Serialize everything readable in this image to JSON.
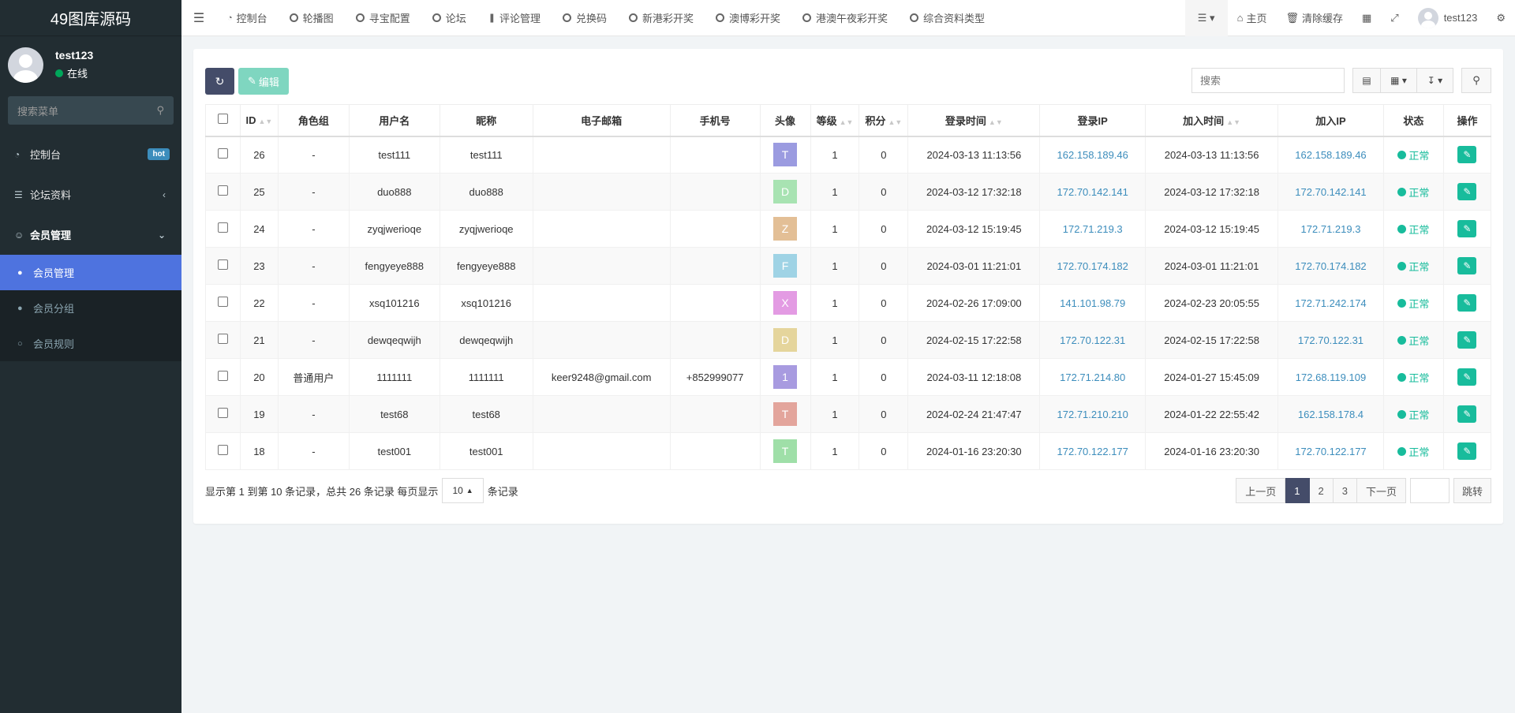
{
  "app": {
    "title": "49图库源码"
  },
  "user": {
    "name": "test123",
    "status": "在线"
  },
  "sidebar": {
    "search_placeholder": "搜索菜单",
    "items": [
      {
        "label": "控制台",
        "badge": "hot"
      },
      {
        "label": "论坛资料"
      },
      {
        "label": "会员管理"
      }
    ],
    "submenu": [
      {
        "label": "会员管理"
      },
      {
        "label": "会员分组"
      },
      {
        "label": "会员规则"
      }
    ]
  },
  "topnav": {
    "tabs": [
      {
        "label": "控制台"
      },
      {
        "label": "轮播图"
      },
      {
        "label": "寻宝配置"
      },
      {
        "label": "论坛"
      },
      {
        "label": "评论管理"
      },
      {
        "label": "兑换码"
      },
      {
        "label": "新港彩开奖"
      },
      {
        "label": "澳博彩开奖"
      },
      {
        "label": "港澳午夜彩开奖"
      },
      {
        "label": "综合资料类型"
      }
    ],
    "home": "主页",
    "clear_cache": "清除缓存",
    "user": "test123"
  },
  "toolbar": {
    "edit_label": "编辑",
    "search_placeholder": "搜索"
  },
  "table": {
    "headers": [
      "ID",
      "角色组",
      "用户名",
      "昵称",
      "电子邮箱",
      "手机号",
      "头像",
      "等级",
      "积分",
      "登录时间",
      "登录IP",
      "加入时间",
      "加入IP",
      "状态",
      "操作"
    ],
    "rows": [
      {
        "id": "26",
        "group": "-",
        "username": "test111",
        "nickname": "test111",
        "email": "",
        "mobile": "",
        "avatar": "T",
        "avatar_color": "#9b9be0",
        "level": "1",
        "score": "0",
        "login_time": "2024-03-13 11:13:56",
        "login_ip": "162.158.189.46",
        "join_time": "2024-03-13 11:13:56",
        "join_ip": "162.158.189.46",
        "status": "正常"
      },
      {
        "id": "25",
        "group": "-",
        "username": "duo888",
        "nickname": "duo888",
        "email": "",
        "mobile": "",
        "avatar": "D",
        "avatar_color": "#a8e3b2",
        "level": "1",
        "score": "0",
        "login_time": "2024-03-12 17:32:18",
        "login_ip": "172.70.142.141",
        "join_time": "2024-03-12 17:32:18",
        "join_ip": "172.70.142.141",
        "status": "正常"
      },
      {
        "id": "24",
        "group": "-",
        "username": "zyqjwerioqe",
        "nickname": "zyqjwerioqe",
        "email": "",
        "mobile": "",
        "avatar": "Z",
        "avatar_color": "#e3bf96",
        "level": "1",
        "score": "0",
        "login_time": "2024-03-12 15:19:45",
        "login_ip": "172.71.219.3",
        "join_time": "2024-03-12 15:19:45",
        "join_ip": "172.71.219.3",
        "status": "正常"
      },
      {
        "id": "23",
        "group": "-",
        "username": "fengyeye888",
        "nickname": "fengyeye888",
        "email": "",
        "mobile": "",
        "avatar": "F",
        "avatar_color": "#9fd3e5",
        "level": "1",
        "score": "0",
        "login_time": "2024-03-01 11:21:01",
        "login_ip": "172.70.174.182",
        "join_time": "2024-03-01 11:21:01",
        "join_ip": "172.70.174.182",
        "status": "正常"
      },
      {
        "id": "22",
        "group": "-",
        "username": "xsq101216",
        "nickname": "xsq101216",
        "email": "",
        "mobile": "",
        "avatar": "X",
        "avatar_color": "#e39be3",
        "level": "1",
        "score": "0",
        "login_time": "2024-02-26 17:09:00",
        "login_ip": "141.101.98.79",
        "join_time": "2024-02-23 20:05:55",
        "join_ip": "172.71.242.174",
        "status": "正常"
      },
      {
        "id": "21",
        "group": "-",
        "username": "dewqeqwijh",
        "nickname": "dewqeqwijh",
        "email": "",
        "mobile": "",
        "avatar": "D",
        "avatar_color": "#e5d59c",
        "level": "1",
        "score": "0",
        "login_time": "2024-02-15 17:22:58",
        "login_ip": "172.70.122.31",
        "join_time": "2024-02-15 17:22:58",
        "join_ip": "172.70.122.31",
        "status": "正常"
      },
      {
        "id": "20",
        "group": "普通用户",
        "username": "1111111",
        "nickname": "1111111",
        "email": "keer9248@gmail.com",
        "mobile": "+852999077",
        "avatar": "1",
        "avatar_color": "#a89be0",
        "level": "1",
        "score": "0",
        "login_time": "2024-03-11 12:18:08",
        "login_ip": "172.71.214.80",
        "join_time": "2024-01-27 15:45:09",
        "join_ip": "172.68.119.109",
        "status": "正常"
      },
      {
        "id": "19",
        "group": "-",
        "username": "test68",
        "nickname": "test68",
        "email": "",
        "mobile": "",
        "avatar": "T",
        "avatar_color": "#e3a59c",
        "level": "1",
        "score": "0",
        "login_time": "2024-02-24 21:47:47",
        "login_ip": "172.71.210.210",
        "join_time": "2024-01-22 22:55:42",
        "join_ip": "162.158.178.4",
        "status": "正常"
      },
      {
        "id": "18",
        "group": "-",
        "username": "test001",
        "nickname": "test001",
        "email": "",
        "mobile": "",
        "avatar": "T",
        "avatar_color": "#9fdfa8",
        "level": "1",
        "score": "0",
        "login_time": "2024-01-16 23:20:30",
        "login_ip": "172.70.122.177",
        "join_time": "2024-01-16 23:20:30",
        "join_ip": "172.70.122.177",
        "status": "正常"
      }
    ]
  },
  "footer": {
    "info": "显示第 1 到第 10 条记录，总共 26 条记录 每页显示",
    "page_size": "10",
    "suffix": "条记录"
  },
  "pagination": {
    "prev": "上一页",
    "pages": [
      "1",
      "2",
      "3"
    ],
    "next": "下一页",
    "jump": "跳转"
  },
  "colors": {
    "accent": "#4e73df",
    "sidebar_bg": "#222d32",
    "success": "#18bc9c",
    "primary_dark": "#444c69"
  }
}
